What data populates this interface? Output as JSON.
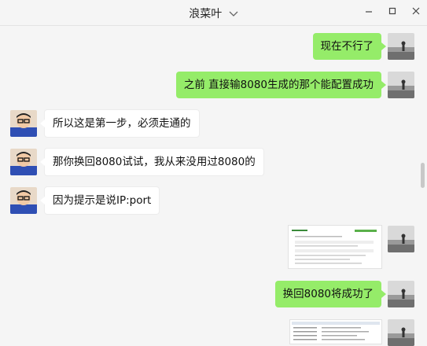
{
  "window": {
    "title": "浪菜叶",
    "controls": [
      "minimize-icon",
      "maximize-icon",
      "close-icon"
    ]
  },
  "messages": [
    {
      "from": "me",
      "type": "text",
      "text": "现在不行了"
    },
    {
      "from": "me",
      "type": "text",
      "text": "之前 直接输8080生成的那个能配置成功"
    },
    {
      "from": "them",
      "type": "text",
      "text": "所以这是第一步，必须走通的"
    },
    {
      "from": "them",
      "type": "text",
      "text": "那你换回8080试试，我从来没用过8080的"
    },
    {
      "from": "them",
      "type": "text",
      "text": "因为提示是说IP:port"
    },
    {
      "from": "me",
      "type": "image"
    },
    {
      "from": "me",
      "type": "text",
      "text": "换回8080将成功了"
    },
    {
      "from": "me",
      "type": "image"
    }
  ],
  "colors": {
    "my_bubble": "#95ec69",
    "their_bubble": "#ffffff",
    "background": "#f5f5f5"
  }
}
